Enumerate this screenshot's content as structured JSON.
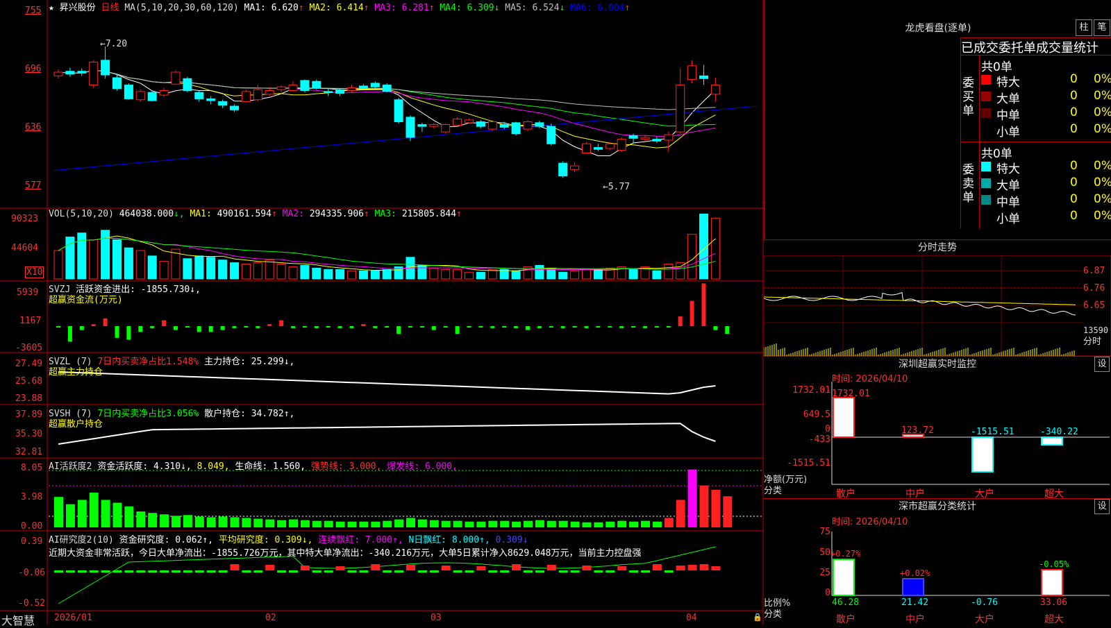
{
  "app": {
    "brand": "大智慧"
  },
  "stock": {
    "name": "昇兴股份",
    "period": "日线"
  },
  "ma_line": {
    "label": "MA(5,10,20,30,60,120)",
    "items": [
      {
        "label": "MA1:",
        "value": "6.620",
        "arrow": "↑",
        "color": "#ffffff"
      },
      {
        "label": "MA2:",
        "value": "6.414",
        "arrow": "↑",
        "color": "#ffff00"
      },
      {
        "label": "MA3:",
        "value": "6.281",
        "arrow": "↑",
        "color": "#ff00ff"
      },
      {
        "label": "MA4:",
        "value": "6.309",
        "arrow": "↓",
        "color": "#00ff00"
      },
      {
        "label": "MA5:",
        "value": "6.524",
        "arrow": "↓",
        "color": "#c0c0c0"
      },
      {
        "label": "MA6:",
        "value": "6.004",
        "arrow": "↑",
        "color": "#0000ff"
      }
    ]
  },
  "price_axis": [
    "755",
    "696",
    "636",
    "577"
  ],
  "price_marks": {
    "high": "7.20",
    "low": "5.77"
  },
  "vol": {
    "label": "VOL(5,10,20)",
    "value": "464038.000",
    "items": [
      {
        "label": "MA1:",
        "value": "490161.594",
        "arrow": "↑",
        "color": "#ffff00"
      },
      {
        "label": "MA2:",
        "value": "294335.906",
        "arrow": "↑",
        "color": "#ff00ff"
      },
      {
        "label": "MA3:",
        "value": "215805.844",
        "arrow": "↑",
        "color": "#00ff00"
      }
    ],
    "axis": [
      "90323",
      "44604"
    ],
    "unit": "X10"
  },
  "svzj": {
    "label": "SVZJ",
    "line1": "活跃资金进出: -1855.730↓,",
    "line2": "超赢资金流(万元)",
    "axis": [
      "5939",
      "1167",
      "-3605"
    ]
  },
  "svzl": {
    "label": "SVZL (7)",
    "ratio": "7日内买卖净占比1.548%",
    "hold": "主力持仓: 25.299↓,",
    "sub": "超赢主力持仓",
    "axis": [
      "27.49",
      "25.68",
      "23.88"
    ]
  },
  "svsh": {
    "label": "SVSH (7)",
    "ratio": "7日内买卖净占比3.056%",
    "hold": "散户持仓: 34.782↑,",
    "sub": "超赢散户持仓",
    "axis": [
      "37.89",
      "35.30",
      "32.81"
    ]
  },
  "ai_active": {
    "label": "AI活跃度2",
    "act": "资金活跃度: 4.310↓,",
    "v2": "8.049,",
    "life": "生命线: 1.560,",
    "strong": "强势线: 3.000,",
    "burst": "爆发线: 6.000,",
    "axis": [
      "8.05",
      "3.98",
      "0.00"
    ]
  },
  "ai_research": {
    "label": "AI研究度2(10)",
    "research": "资金研究度: 0.062↑,",
    "avg": "平均研究度: 0.309↓,",
    "cont": "连续飘红: 7.000↑,",
    "nday": "N日飘红: 8.000↑,",
    "last": "0.309↓",
    "summary": "近期大资金非常活跃，今日大单净流出：-1855.726万元，其中特大单净流出：-340.216万元，大单5日累计净入8629.048万元，当前主力控盘强",
    "axis": [
      "0.39",
      "-0.06",
      "-0.52"
    ]
  },
  "date_axis": [
    "2026/01",
    "02",
    "03",
    "04"
  ],
  "dragon": {
    "title": "龙虎看盘(逐单)",
    "btn1": "柱",
    "btn2": "笔",
    "tabs": "已成交委托单成交量统计",
    "buy_label": "委买单",
    "sell_label": "委卖单",
    "buy_total": "共0单",
    "sell_total": "共0单",
    "rows": [
      {
        "name": "特大",
        "v": "0",
        "p": "0%"
      },
      {
        "name": "大单",
        "v": "0",
        "p": "0%"
      },
      {
        "name": "中单",
        "v": "0",
        "p": "0%"
      },
      {
        "name": "小单",
        "v": "0",
        "p": "0%"
      }
    ],
    "buy_colors": [
      "#ff0000",
      "#990000",
      "#660000",
      "#000000"
    ],
    "sell_colors": [
      "#00ffff",
      "#00aaaa",
      "#008888",
      "#000000"
    ]
  },
  "intraday": {
    "title": "分时走势",
    "axis": [
      "6.87",
      "6.76",
      "6.65"
    ],
    "vol_label": "13590",
    "vol_unit": "分时"
  },
  "monitor": {
    "title": "深圳超赢实时监控",
    "set": "设",
    "time": "时间: 2026/04/10",
    "axis": [
      "1732.01",
      "649.5",
      "0",
      "-433",
      "-1515.51"
    ],
    "unit": "净额(万元)",
    "cat_label": "分类",
    "values": [
      "1732.01",
      "123.72",
      "-1515.51",
      "-340.22"
    ],
    "categories": [
      "散户",
      "中户",
      "大户",
      "超大"
    ]
  },
  "classify": {
    "title": "深市超赢分类统计",
    "set": "设",
    "time": "时间: 2026/04/10",
    "axis": [
      "75",
      "50",
      "25",
      "0"
    ],
    "unit": "比例%",
    "cat_label": "分类",
    "changes": [
      "+0.27%",
      "+0.02%",
      "",
      "-0.05%"
    ],
    "values": [
      "46.28",
      "21.42",
      "-0.76",
      "33.06"
    ],
    "categories": [
      "散户",
      "中户",
      "大户",
      "超大"
    ]
  },
  "chart_data": [
    {
      "type": "candlestick",
      "series": [
        {
          "name": "K",
          "values": [
            [
              6.88,
              6.92,
              6.85,
              6.95
            ],
            [
              6.93,
              6.9,
              6.87,
              6.97
            ],
            [
              6.93,
              6.91,
              6.88,
              6.96
            ],
            [
              6.78,
              7.03,
              6.75,
              7.05
            ],
            [
              7.05,
              6.89,
              6.85,
              7.2
            ],
            [
              6.86,
              6.74,
              6.72,
              6.9
            ],
            [
              6.78,
              6.63,
              6.62,
              6.8
            ],
            [
              6.62,
              6.71,
              6.6,
              6.73
            ],
            [
              6.7,
              6.61,
              6.6,
              6.72
            ],
            [
              6.67,
              6.72,
              6.65,
              6.75
            ],
            [
              6.79,
              6.92,
              6.78,
              6.94
            ],
            [
              6.85,
              6.72,
              6.7,
              6.87
            ],
            [
              6.7,
              6.63,
              6.6,
              6.72
            ],
            [
              6.63,
              6.61,
              6.57,
              6.66
            ],
            [
              6.6,
              6.56,
              6.53,
              6.62
            ],
            [
              6.55,
              6.51,
              6.49,
              6.57
            ],
            [
              6.6,
              6.71,
              6.59,
              6.73
            ],
            [
              6.62,
              6.73,
              6.6,
              6.78
            ],
            [
              6.68,
              6.72,
              6.66,
              6.76
            ],
            [
              6.73,
              6.76,
              6.7,
              6.78
            ],
            [
              6.72,
              6.78,
              6.71,
              6.82
            ],
            [
              6.83,
              6.72,
              6.7,
              6.84
            ],
            [
              6.82,
              6.75,
              6.73,
              6.84
            ],
            [
              6.71,
              6.7,
              6.66,
              6.74
            ],
            [
              6.73,
              6.69,
              6.66,
              6.75
            ],
            [
              6.72,
              6.75,
              6.7,
              6.78
            ],
            [
              6.77,
              6.75,
              6.73,
              6.79
            ],
            [
              6.8,
              6.76,
              6.74,
              6.82
            ],
            [
              6.78,
              6.71,
              6.7,
              6.8
            ],
            [
              6.62,
              6.38,
              6.36,
              6.64
            ],
            [
              6.43,
              6.21,
              6.17,
              6.45
            ],
            [
              6.35,
              6.33,
              6.27,
              6.37
            ],
            [
              6.33,
              6.35,
              6.31,
              6.37
            ],
            [
              6.27,
              6.35,
              6.25,
              6.36
            ],
            [
              6.34,
              6.41,
              6.33,
              6.43
            ],
            [
              6.37,
              6.4,
              6.36,
              6.42
            ],
            [
              6.38,
              6.33,
              6.31,
              6.4
            ],
            [
              6.3,
              6.38,
              6.28,
              6.4
            ],
            [
              6.35,
              6.32,
              6.3,
              6.38
            ],
            [
              6.37,
              6.25,
              6.23,
              6.38
            ],
            [
              6.3,
              6.38,
              6.28,
              6.4
            ],
            [
              6.37,
              6.33,
              6.31,
              6.39
            ],
            [
              6.33,
              6.14,
              6.12,
              6.36
            ],
            [
              5.93,
              5.79,
              5.77,
              5.95
            ],
            [
              5.86,
              5.9,
              5.83,
              5.94
            ],
            [
              6.04,
              6.14,
              6.03,
              6.16
            ],
            [
              6.1,
              6.08,
              6.06,
              6.14
            ],
            [
              6.09,
              6.14,
              6.07,
              6.16
            ],
            [
              6.07,
              6.19,
              6.05,
              6.21
            ],
            [
              6.23,
              6.2,
              6.15,
              6.25
            ],
            [
              6.19,
              6.21,
              6.17,
              6.23
            ],
            [
              6.19,
              6.17,
              6.15,
              6.22
            ],
            [
              6.18,
              6.24,
              6.05,
              6.27
            ],
            [
              6.27,
              6.78,
              6.25,
              6.96
            ],
            [
              6.84,
              6.99,
              6.8,
              7.05
            ],
            [
              6.88,
              6.85,
              6.78,
              7.0
            ],
            [
              6.68,
              6.78,
              6.6,
              6.86
            ]
          ]
        }
      ],
      "ylim": [
        5.5,
        7.6
      ]
    },
    {
      "type": "bar",
      "series": [
        {
          "name": "VOL",
          "values": [
            21,
            31,
            34,
            29,
            36,
            29,
            23,
            21,
            17,
            13,
            22,
            15,
            17,
            16,
            14,
            12,
            11,
            12,
            14,
            11,
            9,
            10,
            8,
            7,
            7,
            6,
            6,
            6,
            7,
            9,
            16,
            10,
            8,
            7,
            7,
            5,
            5,
            7,
            7,
            6,
            9,
            10,
            8,
            5,
            6,
            7,
            7,
            8,
            9,
            7,
            9,
            6,
            11,
            12,
            33,
            48,
            45,
            39
          ]
        }
      ],
      "ylim": [
        0,
        90323
      ]
    }
  ]
}
